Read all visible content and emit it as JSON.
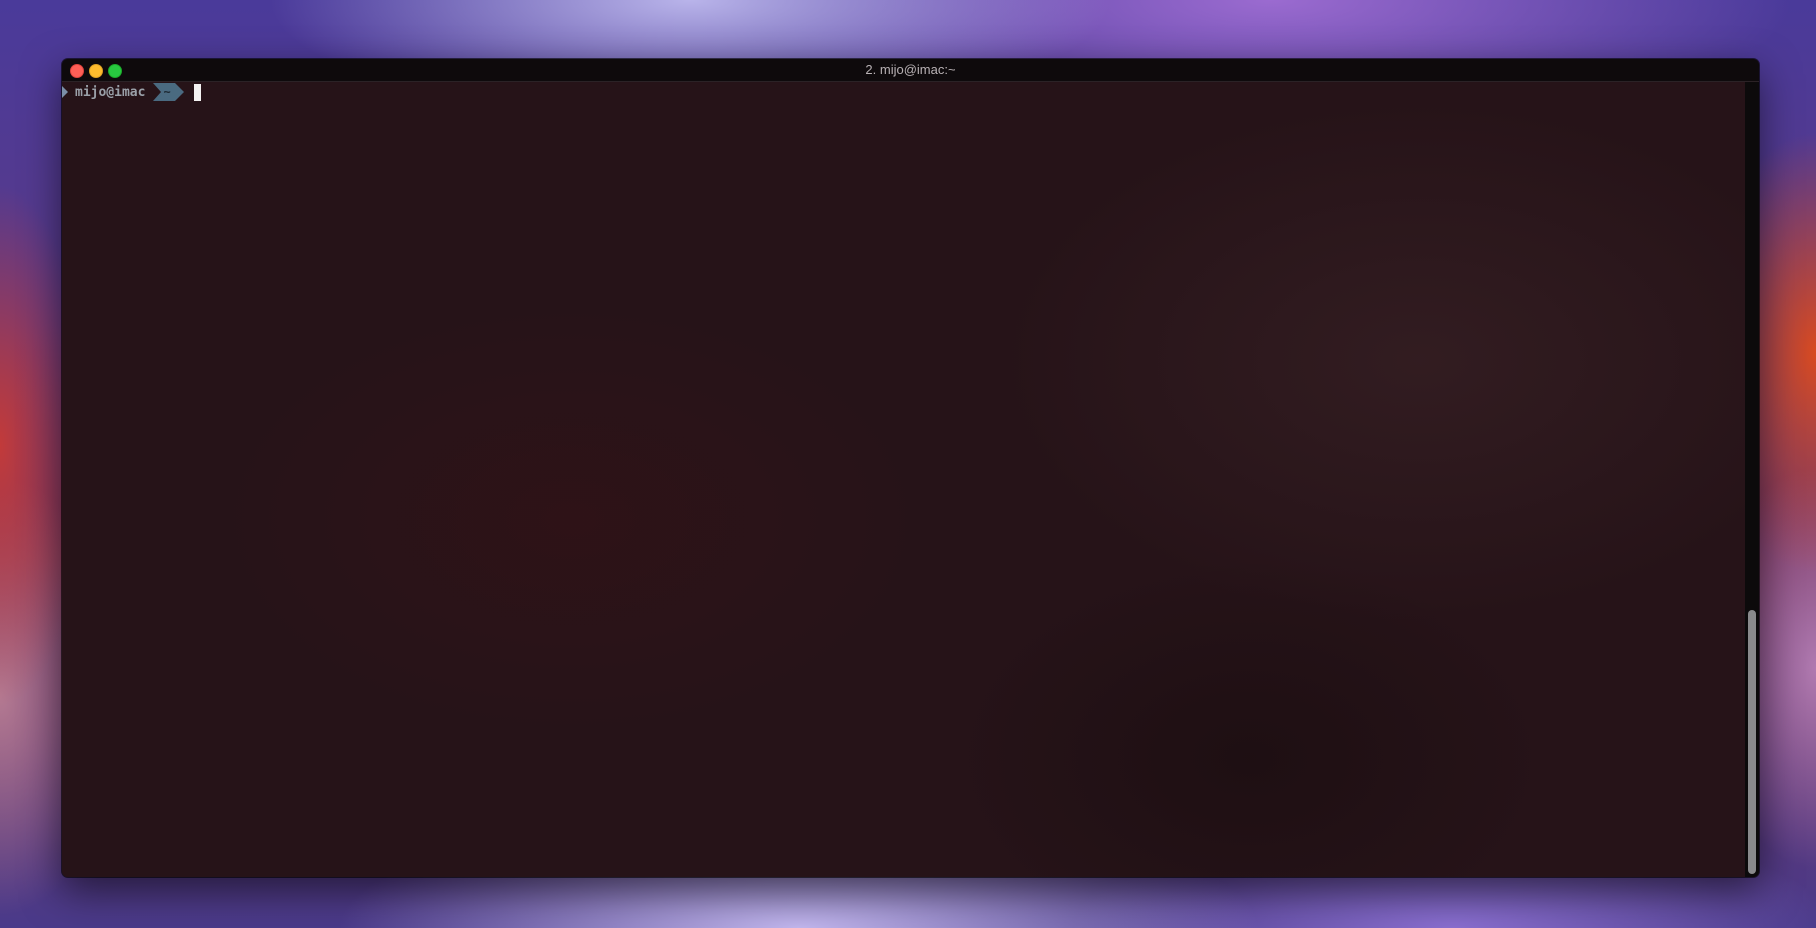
{
  "window": {
    "title": "2. mijo@imac:~",
    "controls": [
      "close",
      "minimize",
      "zoom"
    ]
  },
  "colors": {
    "close": "#fe5f57",
    "minimize": "#febc2e",
    "zoom": "#28c840",
    "prompt_segment": "#4a6a80",
    "terminal_background": "#261318"
  },
  "terminal": {
    "prompt": {
      "marker_icon": "chevron-right-icon",
      "user": "mijo@imac",
      "directory": "~"
    }
  },
  "scrollbar": {
    "position_fraction": 1.0,
    "visible_fraction": 0.34
  }
}
